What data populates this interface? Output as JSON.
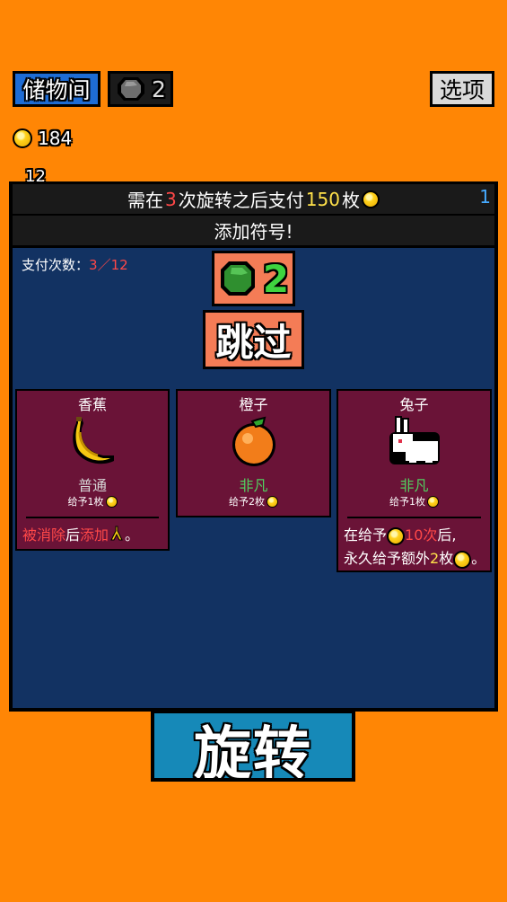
{
  "topbar": {
    "storage_label": "储物间",
    "removal_count": "2",
    "options_label": "选项"
  },
  "coins": "184",
  "peek_text": "12",
  "background_button_label": "旋转",
  "dialog": {
    "header": {
      "part1": "需在",
      "spins": "3",
      "part2": "次旋转之后支付",
      "amount": "150",
      "part3": "枚"
    },
    "header_right_number": "1",
    "subtitle": "添加符号!",
    "pay_count_label": "支付次数：",
    "pay_count_current": "3",
    "pay_count_sep": "／",
    "pay_count_total": "12",
    "reroll_count": "2",
    "skip_label": "跳过"
  },
  "cards": [
    {
      "name": "香蕉",
      "icon": "banana-icon",
      "rarity": "普通",
      "value": "给予1枚",
      "desc_red1": "被消除",
      "desc_mid": "后",
      "desc_red2": "添加",
      "desc_end": "。"
    },
    {
      "name": "橙子",
      "icon": "orange-icon",
      "rarity": "非凡",
      "value": "给予2枚"
    },
    {
      "name": "兔子",
      "icon": "rabbit-icon",
      "rarity": "非凡",
      "value": "给予1枚",
      "desc_l1a": "在给予",
      "desc_l1red": "10次",
      "desc_l1b": "后,",
      "desc_l2a": "永久给予额外",
      "desc_l2num": "2",
      "desc_l2b": "枚",
      "desc_l2end": "。"
    }
  ],
  "colors": {
    "background": "#ff8605",
    "storage_button": "#1e6cd4",
    "dialog_panel": "#123262",
    "card": "#6a1337",
    "button": "#f47c56",
    "highlight_red": "#ff4848",
    "highlight_yellow": "#ffe14a",
    "uncommon_green": "#51d060"
  }
}
